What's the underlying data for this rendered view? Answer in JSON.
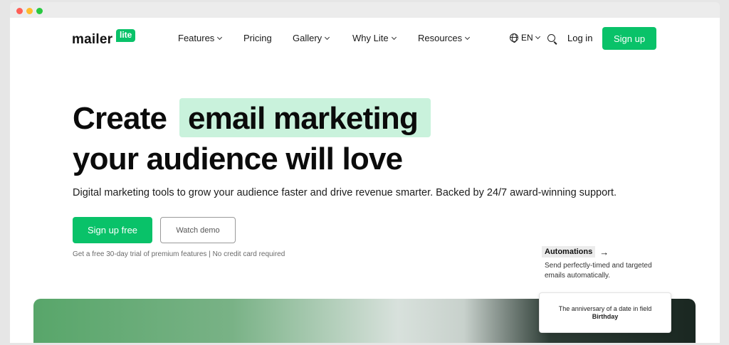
{
  "window": {
    "controls": [
      "close",
      "minimize",
      "maximize"
    ]
  },
  "nav": {
    "logo_word": "mailer",
    "logo_badge": "lite",
    "items": [
      {
        "label": "Features",
        "dropdown": true
      },
      {
        "label": "Pricing",
        "dropdown": false
      },
      {
        "label": "Gallery",
        "dropdown": true
      },
      {
        "label": "Why Lite",
        "dropdown": true
      },
      {
        "label": "Resources",
        "dropdown": true
      }
    ],
    "language": "EN",
    "login": "Log in",
    "signup": "Sign up"
  },
  "hero": {
    "line1_a": "Create",
    "line1_highlight": "email marketing",
    "line2": "your audience will love",
    "subtitle": "Digital marketing tools to grow your audience faster and drive revenue smarter. Backed by 24/7 award-winning support.",
    "cta_primary": "Sign up free",
    "cta_secondary": "Watch demo",
    "trial_note": "Get a free 30-day trial of premium features | No credit card required"
  },
  "automations": {
    "title": "Automations",
    "arrow": "→",
    "description": "Send perfectly-timed and targeted emails automatically."
  },
  "card": {
    "text": "The anniversary of a date in field",
    "field": "Birthday"
  },
  "colors": {
    "brand_green": "#09c269",
    "highlight": "#c9f2dc"
  }
}
